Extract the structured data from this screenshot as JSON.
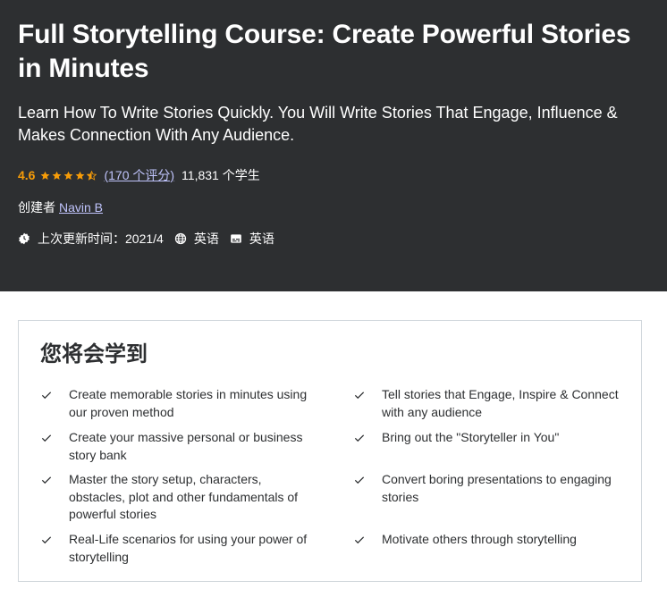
{
  "course": {
    "title": "Full Storytelling Course: Create Powerful Stories in Minutes",
    "subtitle": "Learn How To Write Stories Quickly. You Will Write Stories That Engage, Influence & Makes Connection With Any Audience.",
    "rating": "4.6",
    "rating_count_text": "(170 个评分)",
    "students_text": "11,831 个学生",
    "creator_label": "创建者",
    "creator_name": "Navin B",
    "last_updated": "上次更新时间：2021/4",
    "language": "英语",
    "captions": "英语",
    "stars_filled": 4.5
  },
  "icons": {
    "star": "star-icon",
    "update": "update-badge-icon",
    "language": "globe-icon",
    "captions": "closed-captions-icon",
    "check": "check-icon"
  },
  "colors": {
    "hero_bg": "#2d2f31",
    "rating": "#f69c08",
    "link": "#c0c4fc"
  },
  "learn": {
    "heading": "您将会学到",
    "left": [
      "Create memorable stories in minutes using our proven method",
      "Create your massive personal or business story bank",
      "Master the story setup, characters, obstacles, plot and other fundamentals of powerful stories",
      "Real-Life scenarios for using your power of storytelling"
    ],
    "right": [
      "Tell stories that Engage, Inspire & Connect with any audience",
      "Bring out the \"Storyteller in You\"",
      "Convert boring presentations to engaging stories",
      "Motivate others through storytelling"
    ]
  }
}
